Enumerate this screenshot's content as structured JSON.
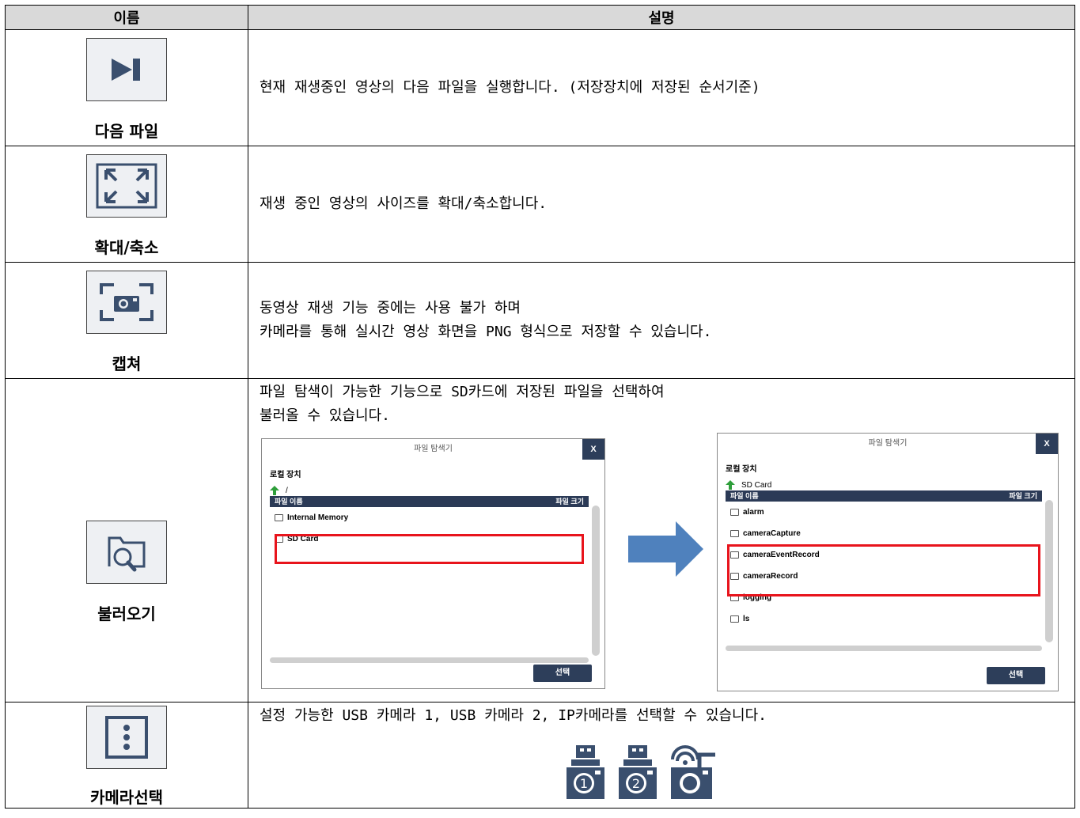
{
  "header": {
    "col_name": "이름",
    "col_desc": "설명"
  },
  "rows": [
    {
      "name": "다음 파일",
      "icon": "next-file-icon",
      "desc": [
        "현재 재생중인 영상의 다음 파일을 실행합니다. (저장장치에 저장된 순서기준)"
      ]
    },
    {
      "name": "확대/축소",
      "icon": "fullscreen-icon",
      "desc": [
        "재생 중인 영상의 사이즈를 확대/축소합니다."
      ]
    },
    {
      "name": "캡쳐",
      "icon": "capture-icon",
      "desc": [
        "동영상 재생 기능 중에는 사용 불가 하며",
        "카메라를 통해 실시간 영상 화면을 PNG 형식으로 저장할 수 있습니다."
      ]
    },
    {
      "name": "불러오기",
      "icon": "open-file-icon",
      "desc": [
        "파일 탐색이 가능한 기능으로 SD카드에 저장된 파일을 선택하여",
        "불러올 수 있습니다."
      ]
    },
    {
      "name": "카메라선택",
      "icon": "camera-select-icon",
      "desc": [
        "설정 가능한 USB 카메라 1, USB 카메라 2, IP카메라를 선택할 수 있습니다."
      ]
    }
  ],
  "explorer_left": {
    "title": "파일 탐색기",
    "close": "X",
    "local": "로컬 장치",
    "path": "/",
    "col_name": "파일 이름",
    "col_size": "파일 크기",
    "items": [
      "Internal Memory",
      "SD Card"
    ],
    "select": "선택"
  },
  "explorer_right": {
    "title": "파일 탐색기",
    "close": "X",
    "local": "로컬 장치",
    "path": "SD Card",
    "col_name": "파일 이름",
    "col_size": "파일 크기",
    "items": [
      "alarm",
      "cameraCapture",
      "cameraEventRecord",
      "cameraRecord",
      "logging",
      "ls"
    ],
    "select": "선택"
  },
  "colors": {
    "icon_blue": "#3a4f6e",
    "highlight_red": "#e8141c",
    "arrow_blue": "#4f81bd",
    "up_arrow_green": "#2e9e3a"
  }
}
